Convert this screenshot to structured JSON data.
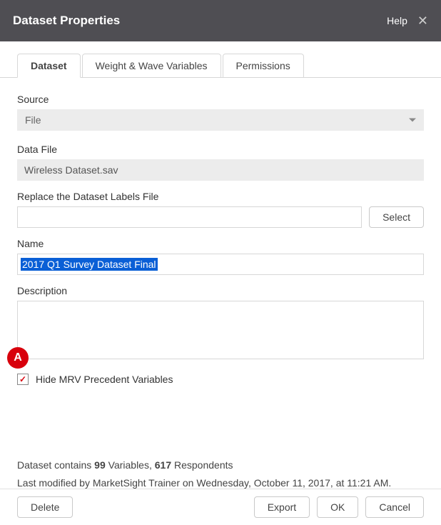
{
  "titlebar": {
    "title": "Dataset Properties",
    "help": "Help"
  },
  "tabs": [
    {
      "label": "Dataset",
      "active": true
    },
    {
      "label": "Weight & Wave Variables",
      "active": false
    },
    {
      "label": "Permissions",
      "active": false
    }
  ],
  "form": {
    "source_label": "Source",
    "source_value": "File",
    "datafile_label": "Data File",
    "datafile_value": "Wireless Dataset.sav",
    "replace_labels_label": "Replace the Dataset Labels File",
    "replace_labels_value": "",
    "select_btn": "Select",
    "name_label": "Name",
    "name_value": "2017 Q1 Survey Dataset Final",
    "description_label": "Description",
    "description_value": "",
    "hide_mrv_label": "Hide MRV Precedent Variables",
    "hide_mrv_checked": true,
    "marker_letter": "A"
  },
  "info": {
    "line1_prefix": "Dataset contains ",
    "var_count": "99",
    "line1_mid": " Variables, ",
    "resp_count": "617",
    "line1_suffix": " Respondents",
    "line2": "Last modified by MarketSight Trainer on Wednesday, October 11, 2017, at 11:21 AM."
  },
  "footer": {
    "delete": "Delete",
    "export": "Export",
    "ok": "OK",
    "cancel": "Cancel"
  }
}
